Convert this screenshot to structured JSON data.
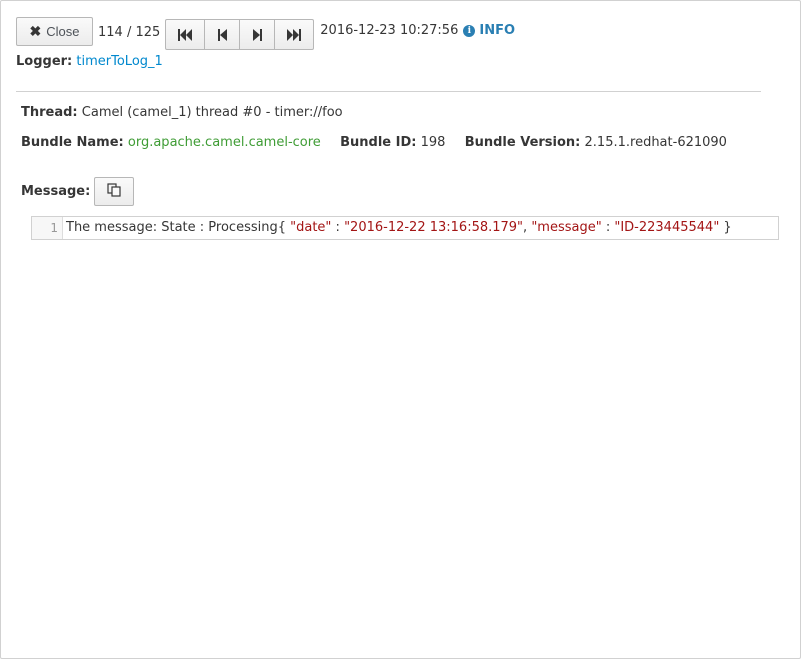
{
  "toolbar": {
    "close_label": "Close",
    "counter": "114 / 125",
    "nav_buttons": [
      "first-icon",
      "previous-icon",
      "next-icon",
      "last-icon"
    ],
    "timestamp": "2016-12-23 10:27:56",
    "level_icon": "info-icon",
    "level": "INFO"
  },
  "logger": {
    "label": "Logger:",
    "value": "timerToLog_1"
  },
  "details": {
    "thread_label": "Thread:",
    "thread_value": "Camel (camel_1) thread #0 - timer://foo",
    "bundle_name_label": "Bundle Name:",
    "bundle_name_value": "org.apache.camel.camel-core",
    "bundle_id_label": "Bundle ID:",
    "bundle_id_value": "198",
    "bundle_version_label": "Bundle Version:",
    "bundle_version_value": "2.15.1.redhat-621090"
  },
  "message": {
    "label": "Message:",
    "copy_icon": "copy-icon",
    "line_number": "1",
    "prefix": "The message: State : Processing{ ",
    "key1": "\"date\"",
    "sep1": " : ",
    "val1": "\"2016-12-22 13:16:58.179\"",
    "comma": ", ",
    "key2": "\"message\"",
    "sep2": " : ",
    "val2": "\"ID-223445544\"",
    "suffix": " }"
  },
  "colors": {
    "link": "#0088ce",
    "bundle_name": "#3f9c35",
    "info": "#2a7fb3",
    "json_string": "#a31515"
  }
}
